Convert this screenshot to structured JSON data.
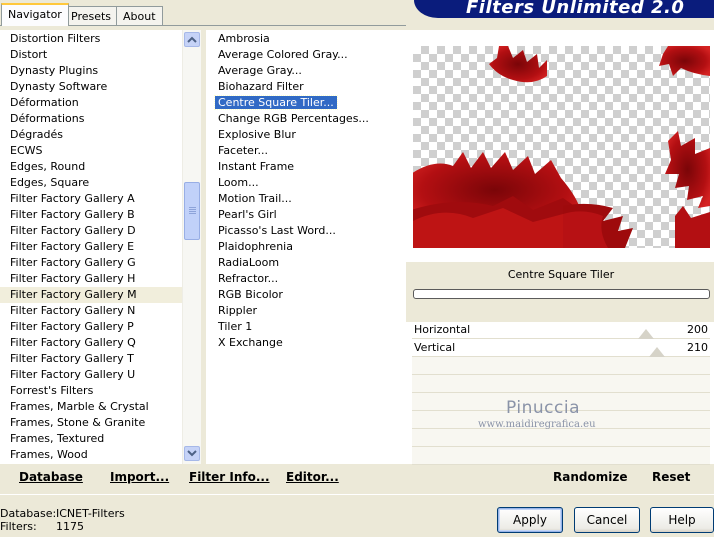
{
  "banner": {
    "title": "Filters Unlimited 2.0"
  },
  "tabs": [
    {
      "label": "Navigator",
      "active": true
    },
    {
      "label": "Presets",
      "active": false
    },
    {
      "label": "About",
      "active": false
    }
  ],
  "categories": {
    "items": [
      "Distortion Filters",
      "Distort",
      "Dynasty Plugins",
      "Dynasty Software",
      "Déformation",
      "Déformations",
      "Dégradés",
      "ECWS",
      "Edges, Round",
      "Edges, Square",
      "Filter Factory Gallery A",
      "Filter Factory Gallery B",
      "Filter Factory Gallery D",
      "Filter Factory Gallery E",
      "Filter Factory Gallery G",
      "Filter Factory Gallery H",
      "Filter Factory Gallery M",
      "Filter Factory Gallery N",
      "Filter Factory Gallery P",
      "Filter Factory Gallery Q",
      "Filter Factory Gallery T",
      "Filter Factory Gallery U",
      "Forrest's Filters",
      "Frames, Marble & Crystal",
      "Frames, Stone & Granite",
      "Frames, Textured",
      "Frames, Wood"
    ],
    "highlighted": "Filter Factory Gallery M"
  },
  "filters": {
    "items": [
      "Ambrosia",
      "Average Colored Gray...",
      "Average Gray...",
      "Biohazard Filter",
      "Centre Square Tiler...",
      "Change RGB Percentages...",
      "Explosive Blur",
      "Faceter...",
      "Instant Frame",
      "Loom...",
      "Motion Trail...",
      "Pearl's Girl",
      "Picasso's Last Word...",
      "Plaidophrenia",
      "RadiaLoom",
      "Refractor...",
      "RGB Bicolor",
      "Rippler",
      "Tiler 1",
      "X Exchange"
    ],
    "selected": "Centre Square Tiler..."
  },
  "bottom_links": {
    "database": "Database",
    "import": "Import...",
    "filter_info": "Filter Info...",
    "editor": "Editor..."
  },
  "preview": {
    "filter_name": "Centre Square Tiler",
    "accent_color": "#B30F12"
  },
  "params": [
    {
      "label": "Horizontal",
      "value": "200",
      "level": 0.784
    },
    {
      "label": "Vertical",
      "value": "210",
      "level": 0.824
    }
  ],
  "actions": {
    "randomize": "Randomize",
    "reset": "Reset"
  },
  "watermark": {
    "name": "Pinuccia",
    "site": "www.maidiregrafica.eu"
  },
  "status": {
    "database_label": "Database:",
    "database_value": "ICNET-Filters",
    "filters_label": "Filters:",
    "filters_value": "1175"
  },
  "buttons": {
    "apply": "Apply",
    "cancel": "Cancel",
    "help": "Help"
  }
}
